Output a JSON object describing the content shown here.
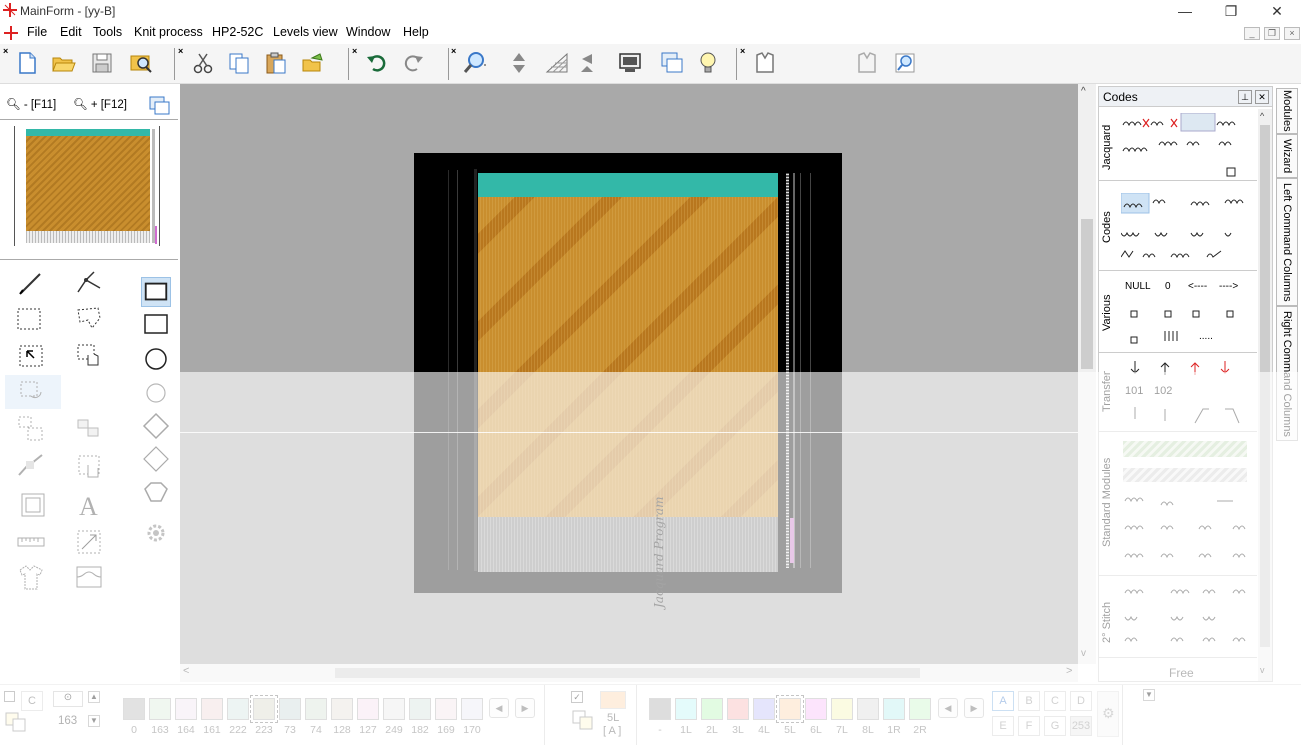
{
  "window": {
    "title": "MainForm - [yy-B]"
  },
  "menu": [
    "File",
    "Edit",
    "Tools",
    "Knit process",
    "HP2-52C",
    "Levels view",
    "Window",
    "Help"
  ],
  "zoom": {
    "zoom_out": "- [F11]",
    "zoom_in": "+ [F12]"
  },
  "document": {
    "watermark": "Jacquard Program"
  },
  "codes_panel": {
    "title": "Codes",
    "tabs": [
      "Jacquard",
      "Codes",
      "Various",
      "Transfer",
      "Standard Modules",
      "2° Stitch"
    ],
    "various": {
      "null": "NULL",
      "zero": "0",
      "left_arrow": "<----",
      "right_arrow": "---->",
      "dots": "....."
    },
    "transfer_labels": [
      "101",
      "102"
    ],
    "footer": "Free"
  },
  "side_tabs": [
    "Modules",
    "Wizard",
    "Left Command Columns",
    "Right Command Columns"
  ],
  "bottom": {
    "c_label": "C",
    "counter_value": "163",
    "yarn_number": "5L",
    "yarn_code": "[ A ]",
    "letters": [
      "A",
      "B",
      "C",
      "D",
      "E",
      "F",
      "G",
      "253"
    ],
    "palette_left": [
      {
        "label": "0",
        "color": "#b2b2b2"
      },
      {
        "label": "163",
        "color": "#d8ead8"
      },
      {
        "label": "164",
        "color": "#efe3ef"
      },
      {
        "label": "161",
        "color": "#ecd6d6"
      },
      {
        "label": "222",
        "color": "#cfe3df"
      },
      {
        "label": "223",
        "color": "#d6d6c6"
      },
      {
        "label": "73",
        "color": "#c6d6d6"
      },
      {
        "label": "74",
        "color": "#d2e0d2"
      },
      {
        "label": "128",
        "color": "#e2dcd6"
      },
      {
        "label": "127",
        "color": "#f4dcec"
      },
      {
        "label": "249",
        "color": "#e6e6e6"
      },
      {
        "label": "182",
        "color": "#cfe0da"
      },
      {
        "label": "169",
        "color": "#f2e2e6"
      },
      {
        "label": "170",
        "color": "#e6e6f2"
      }
    ],
    "palette_right": [
      {
        "label": "-",
        "color": "#a6a6a6"
      },
      {
        "label": "1L",
        "color": "#b8f4f4"
      },
      {
        "label": "2L",
        "color": "#b4f4b4"
      },
      {
        "label": "3L",
        "color": "#f8b0b0"
      },
      {
        "label": "4L",
        "color": "#bcbcf8"
      },
      {
        "label": "5L",
        "color": "#fbd2a8"
      },
      {
        "label": "6L",
        "color": "#f6b8f6"
      },
      {
        "label": "7L",
        "color": "#f4f4b4"
      },
      {
        "label": "8L",
        "color": "#d8d8d8"
      },
      {
        "label": "1R",
        "color": "#b4ecec"
      },
      {
        "label": "2R",
        "color": "#c4f4c4"
      }
    ]
  },
  "colors": {
    "canvas_bg": "#a9a9a9",
    "frame": "#000000",
    "pattern_main": "#c98e2e",
    "pattern_top": "#33b8a8"
  }
}
